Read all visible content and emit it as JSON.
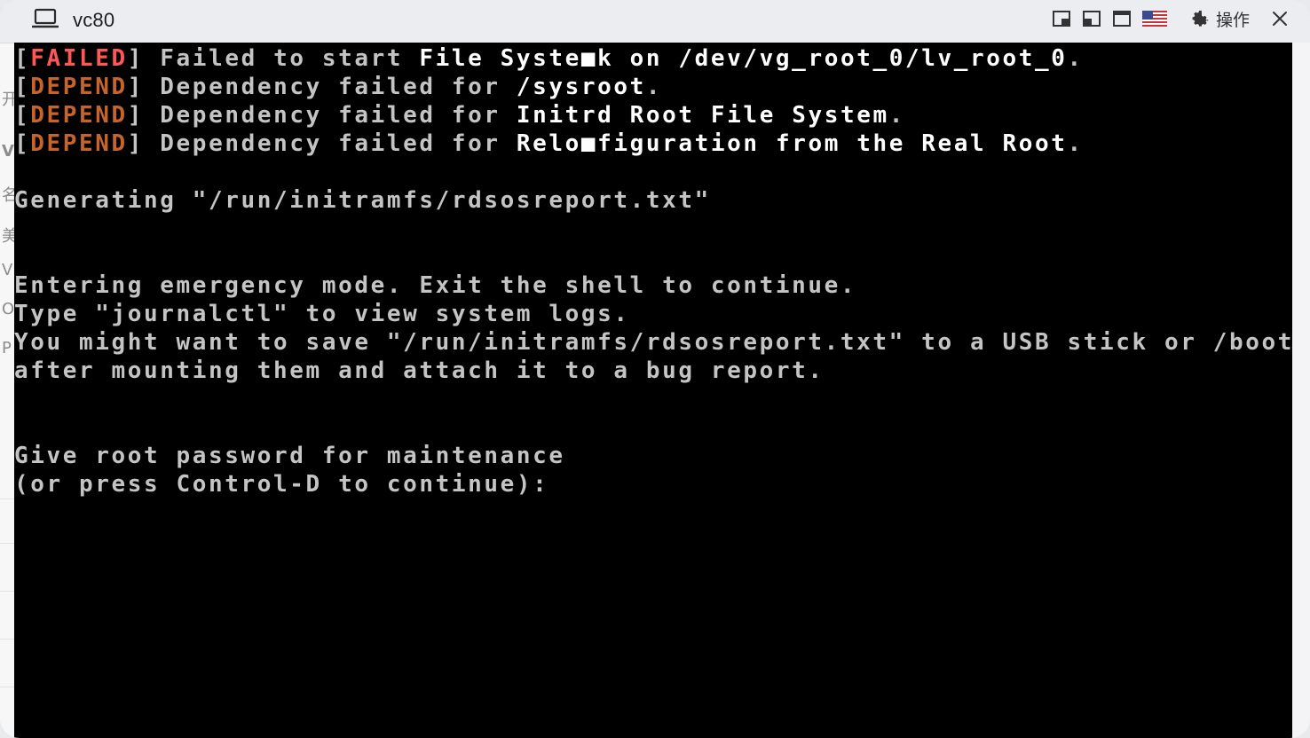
{
  "window": {
    "title": "vc80",
    "ops_label": "操作"
  },
  "icons": {
    "title_icon": "laptop-icon",
    "layout_1": "window-bottom-right-icon",
    "layout_2": "window-bottom-left-icon",
    "layout_3": "window-maximize-icon",
    "keyboard_locale": "us-flag-icon",
    "settings": "gear-icon",
    "close": "close-icon"
  },
  "console": {
    "lines": [
      {
        "pre": "[",
        "tag": "FAILED",
        "tag_class": "red",
        "mid": "] Failed to start ",
        "bright": "File Syste■k on /dev/vg_root_0/lv_root_0",
        "post": "."
      },
      {
        "pre": "[",
        "tag": "DEPEND",
        "tag_class": "dep",
        "mid": "] Dependency failed for ",
        "bright": "/sysroot",
        "post": "."
      },
      {
        "pre": "[",
        "tag": "DEPEND",
        "tag_class": "dep",
        "mid": "] Dependency failed for ",
        "bright": "Initrd Root File System",
        "post": "."
      },
      {
        "pre": "[",
        "tag": "DEPEND",
        "tag_class": "dep",
        "mid": "] Dependency failed for ",
        "bright": "Relo■figuration from the Real Root",
        "post": "."
      },
      {
        "text": ""
      },
      {
        "text": "Generating \"/run/initramfs/rdsosreport.txt\""
      },
      {
        "text": ""
      },
      {
        "text": ""
      },
      {
        "text": "Entering emergency mode. Exit the shell to continue."
      },
      {
        "text": "Type \"journalctl\" to view system logs."
      },
      {
        "text": "You might want to save \"/run/initramfs/rdsosreport.txt\" to a USB stick or /boot"
      },
      {
        "text": "after mounting them and attach it to a bug report."
      },
      {
        "text": ""
      },
      {
        "text": ""
      },
      {
        "text": "Give root password for maintenance"
      },
      {
        "text": "(or press Control-D to continue):"
      }
    ]
  },
  "colors": {
    "failed": "#ff5656",
    "depend": "#c8642a",
    "console_bg": "#000000",
    "console_fg": "#c4c4c4"
  }
}
